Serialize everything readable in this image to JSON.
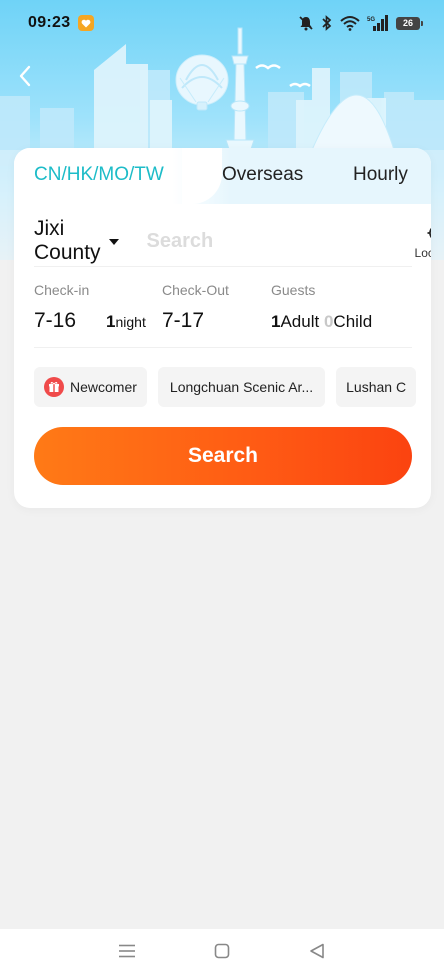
{
  "status_bar": {
    "time": "09:23",
    "battery_level": "26",
    "network": "5G",
    "app_icon": "heart-app-icon"
  },
  "header": {
    "back_icon": "chevron-left-icon"
  },
  "tabs": [
    {
      "label": "CN/HK/MO/TW",
      "active": true
    },
    {
      "label": "Overseas",
      "active": false
    },
    {
      "label": "Hourly",
      "active": false
    }
  ],
  "destination": {
    "city": "Jixi County",
    "search_placeholder": "Search",
    "search_value": "",
    "location_label": "Location"
  },
  "dates": {
    "checkin_label": "Check-in",
    "checkin_value": "7-16",
    "nights_count": "1",
    "nights_unit": "night",
    "checkout_label": "Check-Out",
    "checkout_value": "7-17",
    "guests_label": "Guests",
    "adults_count": "1",
    "adults_unit": "Adult",
    "children_count": "0",
    "children_unit": "Child"
  },
  "chips": [
    {
      "label": "Newcomer",
      "icon": "gift-icon"
    },
    {
      "label": "Longchuan Scenic Ar..."
    },
    {
      "label": "Lushan C"
    }
  ],
  "search_button_label": "Search",
  "colors": {
    "accent_teal": "#1dbcc8",
    "search_orange": "#ff6a14",
    "sky_blue": "#6fd3f7"
  }
}
